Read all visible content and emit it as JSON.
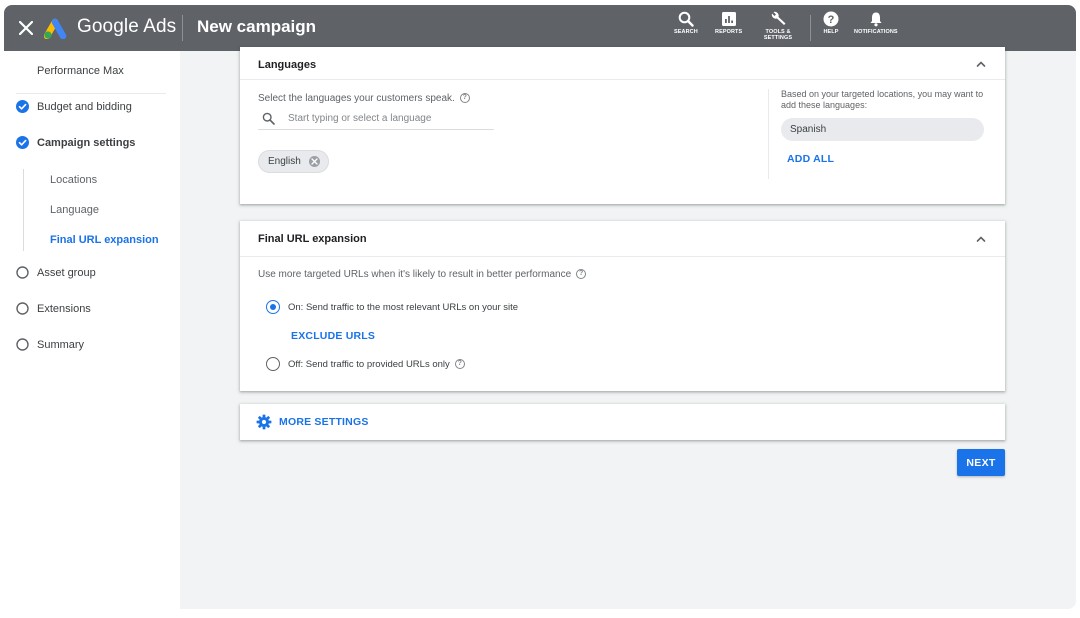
{
  "header": {
    "brand": "Google Ads",
    "title": "New campaign",
    "tools": [
      {
        "label": "SEARCH",
        "icon": "search-icon"
      },
      {
        "label": "REPORTS",
        "icon": "reports-icon"
      },
      {
        "label": "TOOLS & SETTINGS",
        "icon": "wrench-icon"
      },
      {
        "label": "HELP",
        "icon": "help-icon"
      },
      {
        "label": "NOTIFICATIONS",
        "icon": "bell-icon"
      }
    ]
  },
  "sidebar": {
    "items": [
      {
        "label": "Performance Max",
        "state": "none"
      },
      {
        "label": "Budget and bidding",
        "state": "done"
      },
      {
        "label": "Campaign settings",
        "state": "done"
      },
      {
        "label": "Asset group",
        "state": "todo"
      },
      {
        "label": "Extensions",
        "state": "todo"
      },
      {
        "label": "Summary",
        "state": "todo"
      }
    ],
    "sub_items": [
      {
        "label": "Locations",
        "active": false
      },
      {
        "label": "Language",
        "active": false
      },
      {
        "label": "Final URL expansion",
        "active": true
      }
    ]
  },
  "languages": {
    "title": "Languages",
    "prompt": "Select the languages your customers speak.",
    "search_placeholder": "Start typing or select a language",
    "selected": [
      "English"
    ],
    "suggest_text": "Based on your targeted locations, you may want to add these languages:",
    "suggested": [
      "Spanish"
    ],
    "add_all": "ADD ALL"
  },
  "url_expansion": {
    "title": "Final URL expansion",
    "description": "Use more targeted URLs when it's likely to result in better performance",
    "option_on": "On: Send traffic to the most relevant URLs on your site",
    "exclude_label": "EXCLUDE URLS",
    "option_off": "Off: Send traffic to provided URLs only",
    "selected": "on"
  },
  "more_settings": "MORE SETTINGS",
  "next_label": "NEXT",
  "colors": {
    "header_bg": "#5f6368",
    "accent": "#1a73e8",
    "main_bg": "#f1f3f4"
  }
}
